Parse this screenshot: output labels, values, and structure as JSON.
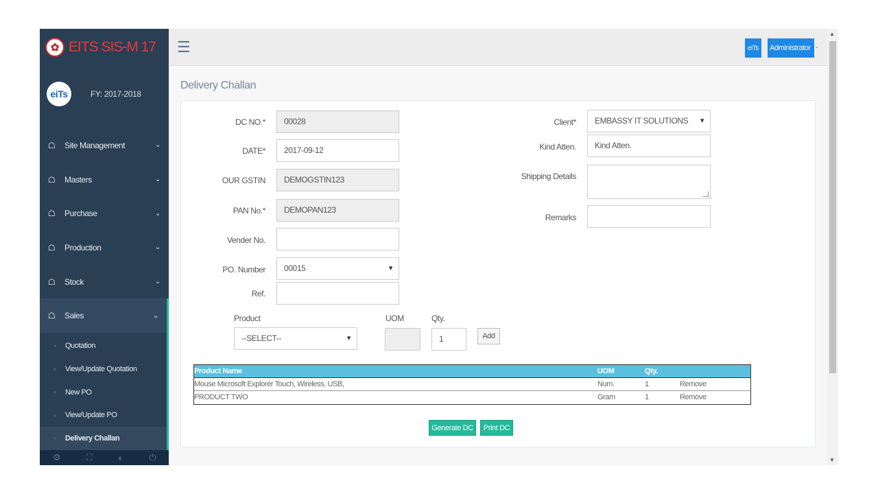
{
  "app": {
    "title": "EITS SIS-M 17",
    "logo_glyph": "✿"
  },
  "profile": {
    "avatar_text": "eiTs",
    "fy": "FY: 2017-2018"
  },
  "sidebar": {
    "items": [
      {
        "label": "Site Management",
        "icon": "home-icon"
      },
      {
        "label": "Masters",
        "icon": "home-icon"
      },
      {
        "label": "Purchase",
        "icon": "home-icon"
      },
      {
        "label": "Production",
        "icon": "home-icon"
      },
      {
        "label": "Stock",
        "icon": "home-icon"
      },
      {
        "label": "Sales",
        "icon": "home-icon"
      }
    ],
    "sales_sub": [
      {
        "label": "Quotation"
      },
      {
        "label": "View/Update Quotation"
      },
      {
        "label": "New PO"
      },
      {
        "label": "View/Update PO"
      },
      {
        "label": "Delivery Challan"
      }
    ],
    "footer_icons": [
      "gear-icon",
      "fullscreen-icon",
      "eye-slash-icon",
      "power-icon"
    ]
  },
  "topbar": {
    "avatar_text": "eiTs",
    "user": "Administrator"
  },
  "page": {
    "title": "Delivery Challan"
  },
  "form": {
    "dc_no": {
      "label": "DC NO.*",
      "value": "00028"
    },
    "date": {
      "label": "DATE*",
      "value": "2017-09-12"
    },
    "gstin": {
      "label": "OUR GSTIN",
      "value": "DEMOGSTIN123"
    },
    "pan": {
      "label": "PAN No.*",
      "value": "DEMOPAN123"
    },
    "vender": {
      "label": "Vender No.",
      "value": ""
    },
    "po_number": {
      "label": "PO. Number",
      "value": "00015"
    },
    "ref": {
      "label": "Ref.",
      "value": ""
    },
    "client": {
      "label": "Client*",
      "value": "EMBASSY IT SOLUTIONS"
    },
    "kind_atten": {
      "label": "Kind Atten.",
      "value": "",
      "placeholder": "Kind Atten."
    },
    "shipping": {
      "label": "Shipping Details",
      "value": ""
    },
    "remarks": {
      "label": "Remarks",
      "value": ""
    },
    "product": {
      "label": "Product",
      "value": "--SELECT--"
    },
    "uom": {
      "label": "UOM",
      "value": ""
    },
    "qty": {
      "label": "Qty.",
      "value": "1"
    },
    "add_label": "Add"
  },
  "table": {
    "headers": [
      "Product Name",
      "UOM",
      "Qty."
    ],
    "rows": [
      {
        "name": "Mouse Microsoft Explorer Touch, Wireless, USB,",
        "uom": "Num.",
        "qty": "1",
        "action": "Remove"
      },
      {
        "name": "PRODUCT TWO",
        "uom": "Gram",
        "qty": "1",
        "action": "Remove"
      }
    ]
  },
  "actions": {
    "generate": "Generate DC",
    "print": "Print DC"
  },
  "colors": {
    "sidebar": "#2a3f54",
    "accent": "#1abb9c",
    "header_row": "#5bc0de",
    "button_green": "#26b99a",
    "admin_blue": "#1e88e5",
    "brand_red": "#e53935"
  }
}
